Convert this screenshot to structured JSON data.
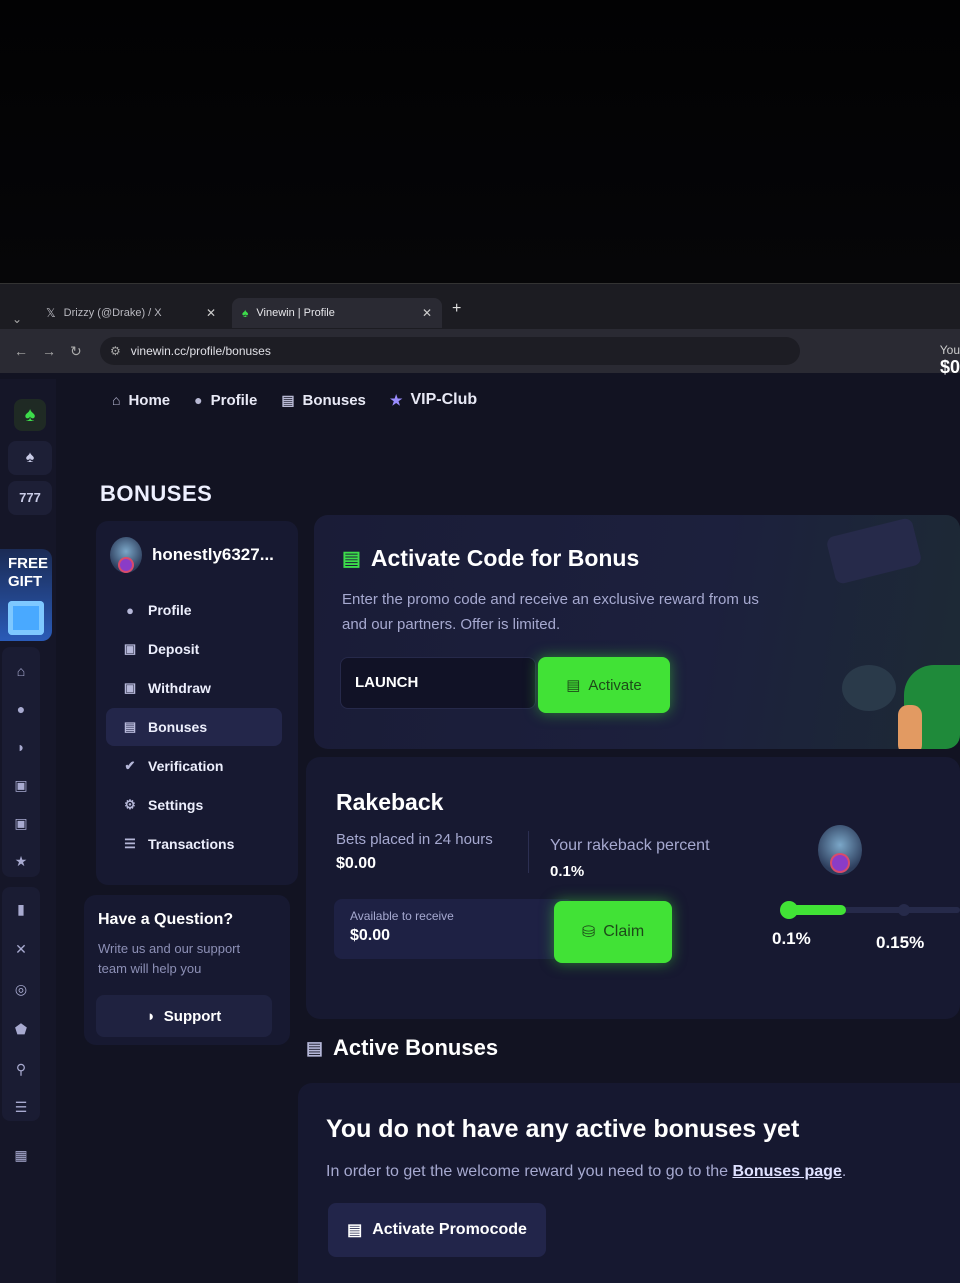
{
  "browser": {
    "tabs": [
      {
        "title": "Drizzy (@Drake) / X",
        "icon": "x-logo-icon"
      },
      {
        "title": "Vinewin | Profile",
        "icon": "vinewin-logo-icon",
        "active": true
      }
    ],
    "url": "vinewin.cc/profile/bonuses"
  },
  "header": {
    "balance_label": "You",
    "balance_value": "$0"
  },
  "rail": {
    "gift_line1": "FREE",
    "gift_line2": "GIFT",
    "item2_glyph": "777"
  },
  "topnav": {
    "items": [
      {
        "label": "Home",
        "icon": "home-icon"
      },
      {
        "label": "Profile",
        "icon": "person-icon"
      },
      {
        "label": "Bonuses",
        "icon": "gift-icon"
      },
      {
        "label": "VIP-Club",
        "icon": "star-icon"
      }
    ]
  },
  "page": {
    "title": "BONUSES"
  },
  "profile": {
    "username": "honestly6327...",
    "menu": [
      {
        "label": "Profile",
        "icon": "person-icon"
      },
      {
        "label": "Deposit",
        "icon": "wallet-in-icon"
      },
      {
        "label": "Withdraw",
        "icon": "wallet-out-icon"
      },
      {
        "label": "Bonuses",
        "icon": "gift-icon",
        "active": true
      },
      {
        "label": "Verification",
        "icon": "check-badge-icon"
      },
      {
        "label": "Settings",
        "icon": "gear-icon"
      },
      {
        "label": "Transactions",
        "icon": "list-icon"
      }
    ]
  },
  "help": {
    "title": "Have a Question?",
    "text": "Write us and our support team will help you",
    "button": "Support"
  },
  "promo": {
    "title": "Activate Code for Bonus",
    "description": "Enter the promo code and receive an exclusive reward from us and our partners. Offer is limited.",
    "code_value": "LAUNCH",
    "button": "Activate"
  },
  "rakeback": {
    "title": "Rakeback",
    "bets_label": "Bets placed in 24 hours",
    "bets_value": "$0.00",
    "percent_label": "Your rakeback percent",
    "percent_value": "0.1%",
    "available_label": "Available to receive",
    "available_value": "$0.00",
    "claim_button": "Claim",
    "progress_fraction": 0.35,
    "tiers": [
      "0.1%",
      "0.15%"
    ]
  },
  "active_bonuses": {
    "title": "Active Bonuses",
    "empty_title": "You do not have any active bonuses yet",
    "empty_text": "In order to get the welcome reward you need to go to the",
    "empty_link": "Bonuses page",
    "empty_suffix": ".",
    "button": "Activate Promocode"
  },
  "colors": {
    "accent": "#41e236",
    "background": "#121322",
    "card": "#171931"
  }
}
